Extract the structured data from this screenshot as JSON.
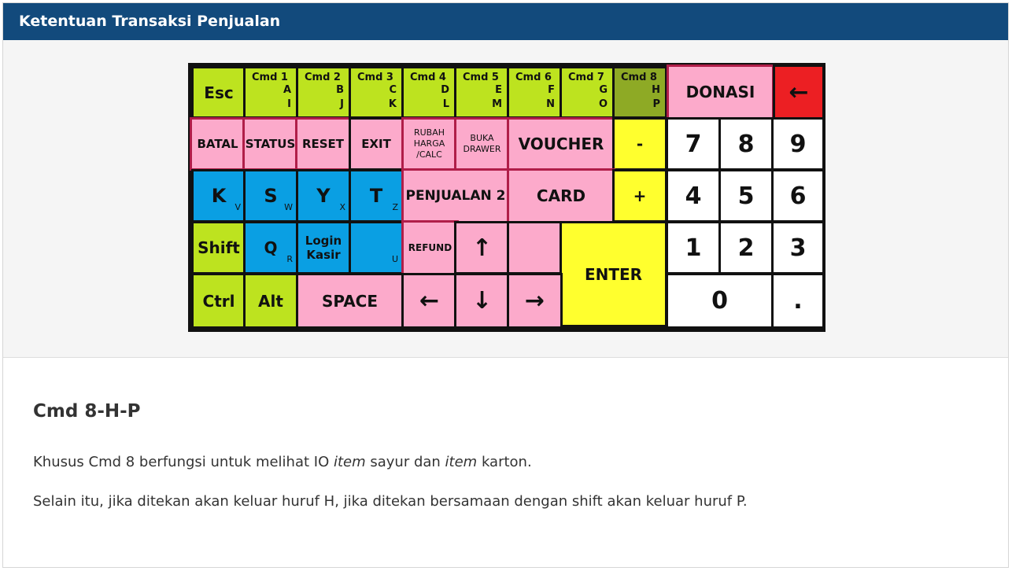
{
  "header": {
    "title": "Ketentuan Transaksi Penjualan"
  },
  "keyboard": {
    "esc": "Esc",
    "cmd": [
      {
        "top": "Cmd  1",
        "mid": "A",
        "bot": "I"
      },
      {
        "top": "Cmd  2",
        "mid": "B",
        "bot": "J"
      },
      {
        "top": "Cmd  3",
        "mid": "C",
        "bot": "K"
      },
      {
        "top": "Cmd  4",
        "mid": "D",
        "bot": "L"
      },
      {
        "top": "Cmd  5",
        "mid": "E",
        "bot": "M"
      },
      {
        "top": "Cmd  6",
        "mid": "F",
        "bot": "N"
      },
      {
        "top": "Cmd  7",
        "mid": "G",
        "bot": "O"
      },
      {
        "top": "Cmd  8",
        "mid": "H",
        "bot": "P"
      }
    ],
    "donasi": "DONASI",
    "backspace": "←",
    "batal": "BATAL",
    "status": "STATUS",
    "reset": "RESET",
    "exit": "EXIT",
    "rubah_1": "RUBAH",
    "rubah_2": "HARGA",
    "rubah_3": "/CALC",
    "buka_1": "BUKA",
    "buka_2": "DRAWER",
    "voucher": "VOUCHER",
    "minus": "-",
    "plus": "+",
    "k": "K",
    "k_sub": "V",
    "s": "S",
    "s_sub": "W",
    "y": "Y",
    "y_sub": "X",
    "t": "T",
    "t_sub": "Z",
    "penjualan2": "PENJUALAN 2",
    "card": "CARD",
    "shift": "Shift",
    "q": "Q",
    "q_sub": "R",
    "login_1": "Login",
    "login_2": "Kasir",
    "u_sub": "U",
    "refund": "REFUND",
    "up": "↑",
    "enter": "ENTER",
    "ctrl": "Ctrl",
    "alt": "Alt",
    "space": "SPACE",
    "left": "←",
    "down": "↓",
    "right": "→",
    "digits": [
      "7",
      "8",
      "9",
      "4",
      "5",
      "6",
      "1",
      "2",
      "3",
      "0",
      "."
    ]
  },
  "content": {
    "heading": "Cmd 8-H-P",
    "p1_a": "Khusus Cmd 8 berfungsi untuk melihat IO ",
    "p1_b": "item",
    "p1_c": " sayur dan ",
    "p1_d": "item",
    "p1_e": " karton.",
    "p2": "Selain itu, jika ditekan akan keluar huruf H, jika ditekan bersamaan dengan shift akan keluar huruf P."
  }
}
